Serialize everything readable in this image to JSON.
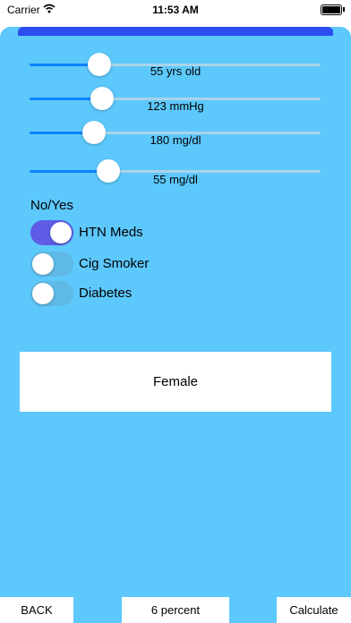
{
  "status_bar": {
    "carrier": "Carrier",
    "time": "11:53 AM"
  },
  "sliders": [
    {
      "value_label": "55 yrs old",
      "level": 0.24
    },
    {
      "value_label": "123 mmHg",
      "level": 0.25
    },
    {
      "value_label": "180 mg/dl",
      "level": 0.22
    },
    {
      "value_label": "55 mg/dl",
      "level": 0.27
    }
  ],
  "section_label": "No/Yes",
  "toggles": [
    {
      "label": "HTN Meds",
      "on": true
    },
    {
      "label": "Cig Smoker",
      "on": false
    },
    {
      "label": "Diabetes",
      "on": false
    }
  ],
  "gender_button": "Female",
  "bottom": {
    "back": "BACK",
    "result": "6 percent",
    "calculate": "Calculate"
  },
  "colors": {
    "background": "#5dc8fc",
    "slider_fill": "#0a84ff",
    "switch_on": "#5e5ce6",
    "header_bar": "#2a4ef0"
  }
}
